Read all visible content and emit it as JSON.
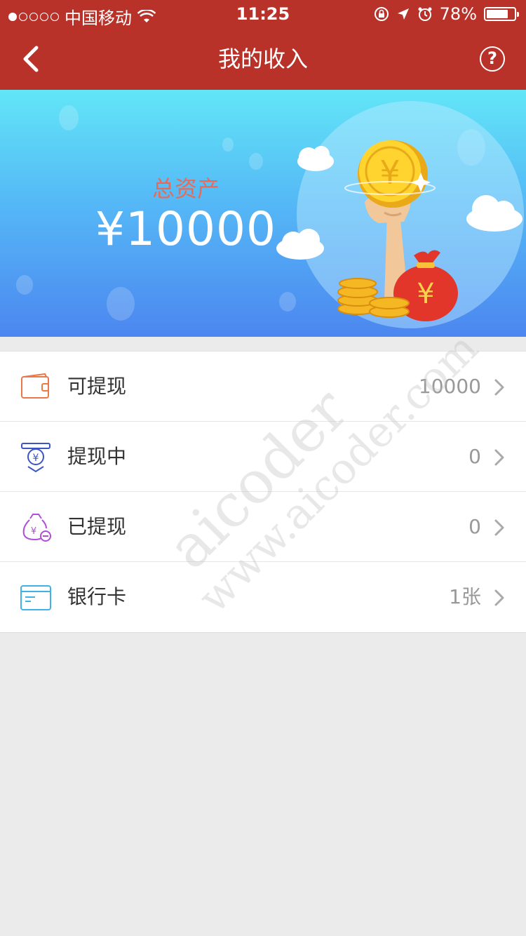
{
  "status_bar": {
    "carrier": "中国移动",
    "time": "11:25",
    "battery": "78%",
    "battery_level": 0.78
  },
  "nav": {
    "title": "我的收入",
    "help_label": "?"
  },
  "banner": {
    "asset_label": "总资产",
    "asset_amount": "¥10000"
  },
  "list": {
    "items": [
      {
        "label": "可提现",
        "value": "10000",
        "icon": "wallet-icon",
        "color": "#e8794a"
      },
      {
        "label": "提现中",
        "value": "0",
        "icon": "withdrawing-icon",
        "color": "#3b55c8"
      },
      {
        "label": "已提现",
        "value": "0",
        "icon": "withdrawn-bag-icon",
        "color": "#b04fd6"
      },
      {
        "label": "银行卡",
        "value": "1张",
        "icon": "bank-card-icon",
        "color": "#3fb3e6"
      }
    ]
  },
  "watermark": {
    "line1": "aicoder",
    "line2": "www.aicoder.com"
  },
  "colors": {
    "header": "#b9322a",
    "asset_label": "#e86a59"
  }
}
